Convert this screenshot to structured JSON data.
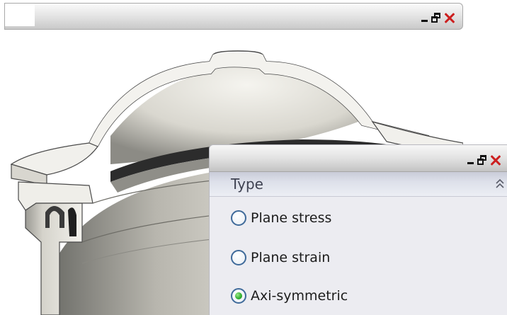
{
  "back_window": {
    "controls": {
      "minimize_icon": "minimize-icon",
      "restore_icon": "restore-icon",
      "close_icon": "close-icon"
    }
  },
  "front_window": {
    "controls": {
      "minimize_icon": "minimize-icon",
      "restore_icon": "restore-icon",
      "close_icon": "close-icon"
    },
    "section": {
      "title": "Type",
      "collapse_icon": "double-chevron-up-icon"
    },
    "options": [
      {
        "label": "Plane stress",
        "checked": false
      },
      {
        "label": "Plane strain",
        "checked": false
      },
      {
        "label": "Axi-symmetric",
        "checked": true
      }
    ]
  },
  "colors": {
    "close": "#cc1f1f",
    "radio_checked": "#34b232",
    "radio_border": "#3f6a9a"
  }
}
